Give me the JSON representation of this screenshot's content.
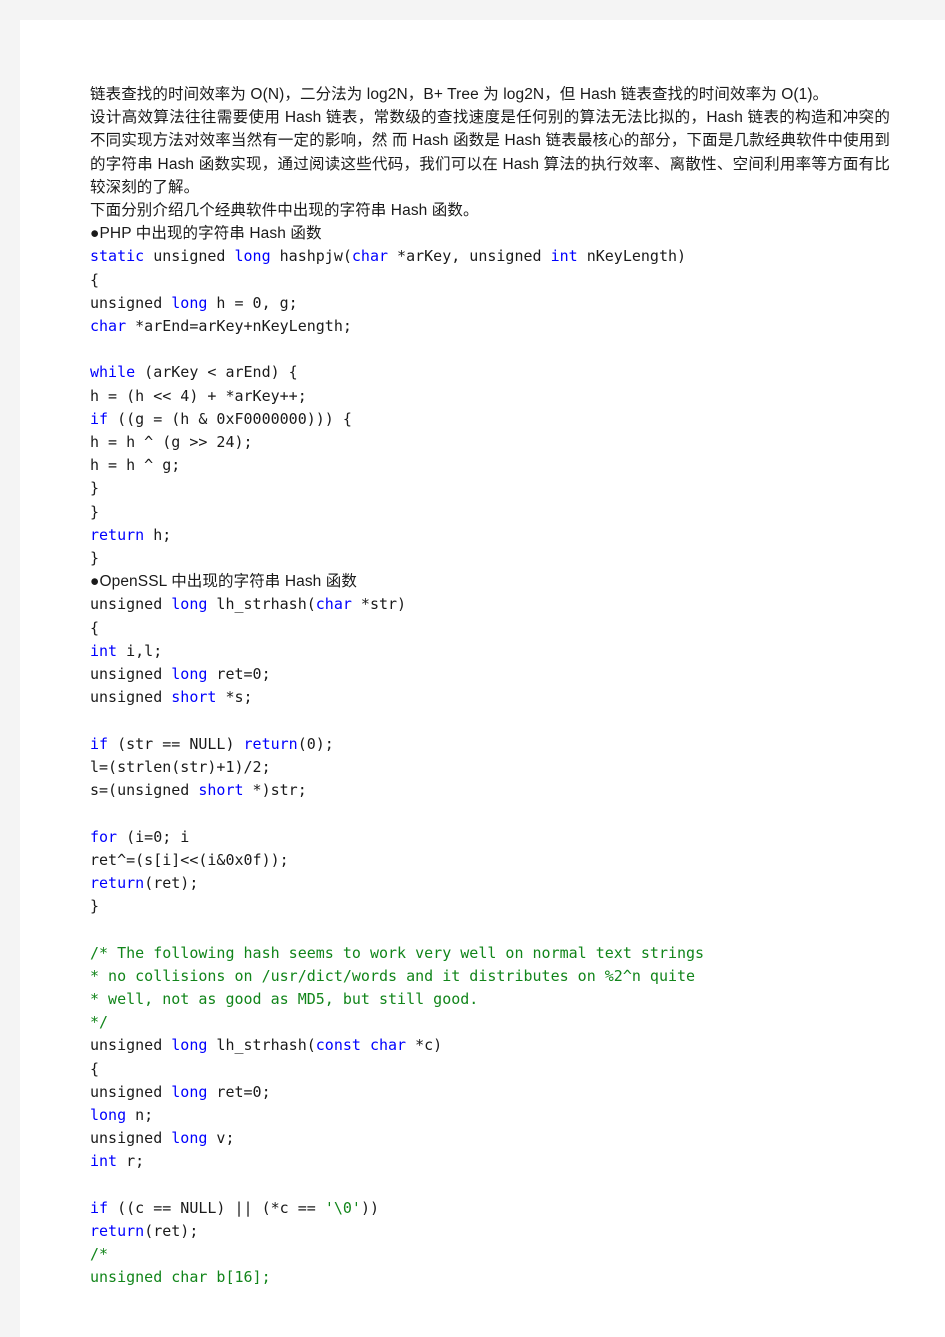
{
  "page": {
    "background_color": "#f4f4f4",
    "paper_color": "#ffffff"
  },
  "colors": {
    "text": "#1a1a1a",
    "keyword": "#0000ff",
    "comment": "#11851a",
    "string": "#11851a"
  },
  "document": {
    "paragraphs": {
      "intro_1": "链表查找的时间效率为 O(N)，二分法为 log2N，B+ Tree 为 log2N，但 Hash 链表查找的时间效率为 O(1)。",
      "intro_2": "设计高效算法往往需要使用 Hash 链表，常数级的查找速度是任何别的算法无法比拟的，Hash 链表的构造和冲突的不同实现方法对效率当然有一定的影响，然 而 Hash 函数是 Hash 链表最核心的部分，下面是几款经典软件中使用到的字符串 Hash 函数实现，通过阅读这些代码，我们可以在 Hash 算法的执行效率、离散性、空间利用率等方面有比较深刻的了解。",
      "intro_3": "下面分别介绍几个经典软件中出现的字符串 Hash 函数。"
    },
    "sections": [
      {
        "heading": "●PHP 中出现的字符串 Hash 函数",
        "code": [
          [
            {
              "t": "static",
              "c": "kw"
            },
            {
              "t": " unsigned ",
              "c": ""
            },
            {
              "t": "long",
              "c": "kw"
            },
            {
              "t": " hashpjw(",
              "c": ""
            },
            {
              "t": "char",
              "c": "kw"
            },
            {
              "t": " *arKey, unsigned ",
              "c": ""
            },
            {
              "t": "int",
              "c": "kw"
            },
            {
              "t": " nKeyLength)",
              "c": ""
            }
          ],
          [
            {
              "t": "{",
              "c": ""
            }
          ],
          [
            {
              "t": "unsigned ",
              "c": ""
            },
            {
              "t": "long",
              "c": "kw"
            },
            {
              "t": " h = 0, g;",
              "c": ""
            }
          ],
          [
            {
              "t": "char",
              "c": "kw"
            },
            {
              "t": " *arEnd=arKey+nKeyLength;",
              "c": ""
            }
          ],
          [
            {
              "t": "",
              "c": ""
            }
          ],
          [
            {
              "t": "while",
              "c": "kw"
            },
            {
              "t": " (arKey < arEnd) {",
              "c": ""
            }
          ],
          [
            {
              "t": "h = (h << 4) + *arKey++;",
              "c": ""
            }
          ],
          [
            {
              "t": "if",
              "c": "kw"
            },
            {
              "t": " ((g = (h & 0xF0000000))) {",
              "c": ""
            }
          ],
          [
            {
              "t": "h = h ^ (g >> 24);",
              "c": ""
            }
          ],
          [
            {
              "t": "h = h ^ g;",
              "c": ""
            }
          ],
          [
            {
              "t": "}",
              "c": ""
            }
          ],
          [
            {
              "t": "}",
              "c": ""
            }
          ],
          [
            {
              "t": "return",
              "c": "kw"
            },
            {
              "t": " h;",
              "c": ""
            }
          ],
          [
            {
              "t": "}",
              "c": ""
            }
          ]
        ]
      },
      {
        "heading": "●OpenSSL 中出现的字符串 Hash 函数",
        "code": [
          [
            {
              "t": "unsigned ",
              "c": ""
            },
            {
              "t": "long",
              "c": "kw"
            },
            {
              "t": " lh_strhash(",
              "c": ""
            },
            {
              "t": "char",
              "c": "kw"
            },
            {
              "t": " *str)",
              "c": ""
            }
          ],
          [
            {
              "t": "{",
              "c": ""
            }
          ],
          [
            {
              "t": "int",
              "c": "kw"
            },
            {
              "t": " i,l;",
              "c": ""
            }
          ],
          [
            {
              "t": "unsigned ",
              "c": ""
            },
            {
              "t": "long",
              "c": "kw"
            },
            {
              "t": " ret=0;",
              "c": ""
            }
          ],
          [
            {
              "t": "unsigned ",
              "c": ""
            },
            {
              "t": "short",
              "c": "kw"
            },
            {
              "t": " *s;",
              "c": ""
            }
          ],
          [
            {
              "t": "",
              "c": ""
            }
          ],
          [
            {
              "t": "if",
              "c": "kw"
            },
            {
              "t": " (str == NULL) ",
              "c": ""
            },
            {
              "t": "return",
              "c": "kw"
            },
            {
              "t": "(0);",
              "c": ""
            }
          ],
          [
            {
              "t": "l=(strlen(str)+1)/2;",
              "c": ""
            }
          ],
          [
            {
              "t": "s=(unsigned ",
              "c": ""
            },
            {
              "t": "short",
              "c": "kw"
            },
            {
              "t": " *)str;",
              "c": ""
            }
          ],
          [
            {
              "t": "",
              "c": ""
            }
          ],
          [
            {
              "t": "for",
              "c": "kw"
            },
            {
              "t": " (i=0; i",
              "c": ""
            }
          ],
          [
            {
              "t": "ret^=(s[i]<<(i&0x0f));",
              "c": ""
            }
          ],
          [
            {
              "t": "return",
              "c": "kw"
            },
            {
              "t": "(ret);",
              "c": ""
            }
          ],
          [
            {
              "t": "}",
              "c": ""
            }
          ],
          [
            {
              "t": "",
              "c": ""
            }
          ],
          [
            {
              "t": "/* The following hash seems to work very well on normal text strings",
              "c": "cmt"
            }
          ],
          [
            {
              "t": "* no collisions on /usr/dict/words and it distributes on %2^n quite",
              "c": "cmt"
            }
          ],
          [
            {
              "t": "* well, not as good as MD5, but still good.",
              "c": "cmt"
            }
          ],
          [
            {
              "t": "*/",
              "c": "cmt"
            }
          ],
          [
            {
              "t": "unsigned ",
              "c": ""
            },
            {
              "t": "long",
              "c": "kw"
            },
            {
              "t": " lh_strhash(",
              "c": ""
            },
            {
              "t": "const char",
              "c": "kw"
            },
            {
              "t": " *c)",
              "c": ""
            }
          ],
          [
            {
              "t": "{",
              "c": ""
            }
          ],
          [
            {
              "t": "unsigned ",
              "c": ""
            },
            {
              "t": "long",
              "c": "kw"
            },
            {
              "t": " ret=0;",
              "c": ""
            }
          ],
          [
            {
              "t": "long",
              "c": "kw"
            },
            {
              "t": " n;",
              "c": ""
            }
          ],
          [
            {
              "t": "unsigned ",
              "c": ""
            },
            {
              "t": "long",
              "c": "kw"
            },
            {
              "t": " v;",
              "c": ""
            }
          ],
          [
            {
              "t": "int",
              "c": "kw"
            },
            {
              "t": " r;",
              "c": ""
            }
          ],
          [
            {
              "t": "",
              "c": ""
            }
          ],
          [
            {
              "t": "if",
              "c": "kw"
            },
            {
              "t": " ((c == NULL) || (*c == ",
              "c": ""
            },
            {
              "t": "'\\0'",
              "c": "str"
            },
            {
              "t": "))",
              "c": ""
            }
          ],
          [
            {
              "t": "return",
              "c": "kw"
            },
            {
              "t": "(ret);",
              "c": ""
            }
          ],
          [
            {
              "t": "/*",
              "c": "cmt"
            }
          ],
          [
            {
              "t": "unsigned char b[16];",
              "c": "cmt"
            }
          ]
        ]
      }
    ]
  }
}
